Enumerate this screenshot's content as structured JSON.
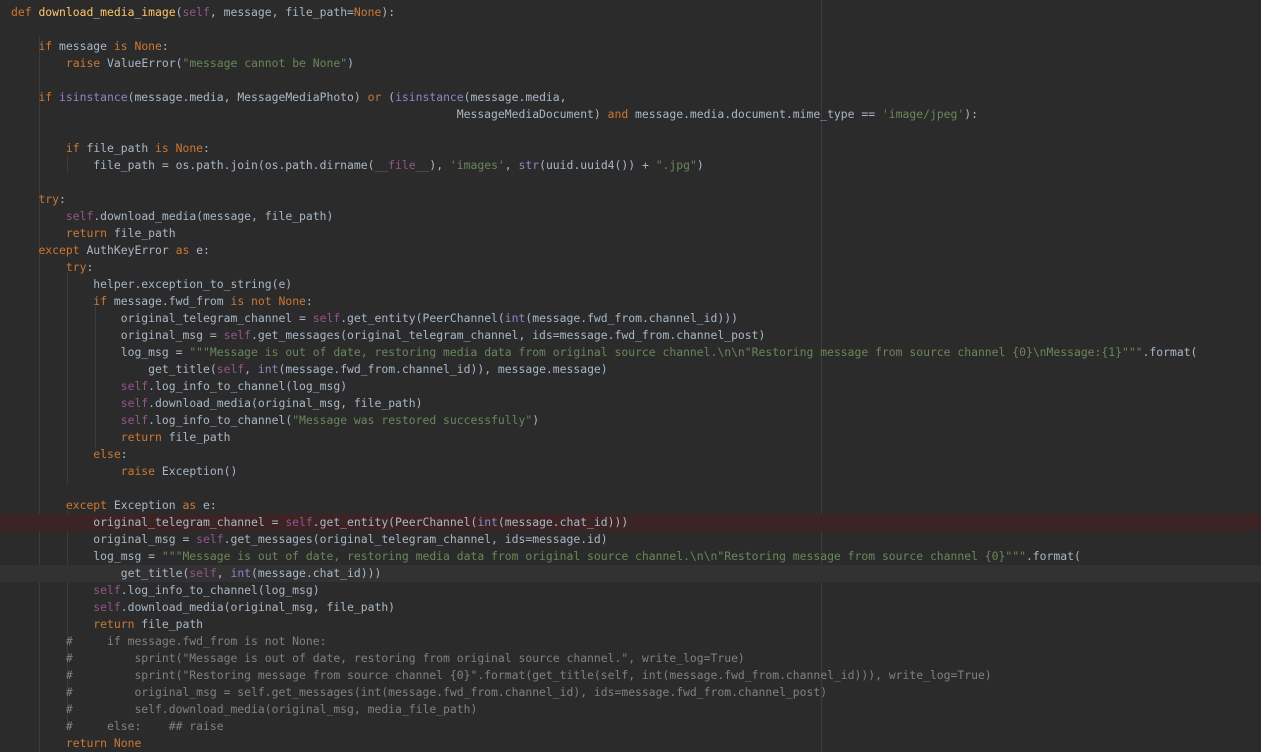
{
  "editor": {
    "language": "python",
    "theme_colors": {
      "background": "#2b2b2b",
      "default_text": "#a9b7c6",
      "keyword": "#cc7832",
      "function_name": "#ffc66d",
      "self": "#94558d",
      "string": "#6a8759",
      "builtin": "#8888c6",
      "comment": "#808080",
      "error_line": "#3d2424",
      "caret_line": "#323232"
    },
    "lines": [
      "def download_media_image(self, message, file_path=None):",
      "",
      "    if message is None:",
      "        raise ValueError(\"message cannot be None\")",
      "",
      "    if isinstance(message.media, MessageMediaPhoto) or (isinstance(message.media,",
      "                                                                 MessageMediaDocument) and message.media.document.mime_type == 'image/jpeg'):",
      "",
      "        if file_path is None:",
      "            file_path = os.path.join(os.path.dirname(__file__), 'images', str(uuid.uuid4()) + \".jpg\")",
      "",
      "    try:",
      "        self.download_media(message, file_path)",
      "        return file_path",
      "    except AuthKeyError as e:",
      "        try:",
      "            helper.exception_to_string(e)",
      "            if message.fwd_from is not None:",
      "                original_telegram_channel = self.get_entity(PeerChannel(int(message.fwd_from.channel_id)))",
      "                original_msg = self.get_messages(original_telegram_channel, ids=message.fwd_from.channel_post)",
      "                log_msg = \"\"\"Message is out of date, restoring media data from original source channel.\\n\\n\"Restoring message from source channel {0}\\nMessage:{1}\"\"\".format(",
      "                    get_title(self, int(message.fwd_from.channel_id)), message.message)",
      "                self.log_info_to_channel(log_msg)",
      "                self.download_media(original_msg, file_path)",
      "                self.log_info_to_channel(\"Message was restored successfully\")",
      "                return file_path",
      "            else:",
      "                raise Exception()",
      "",
      "        except Exception as e:",
      "            original_telegram_channel = self.get_entity(PeerChannel(int(message.chat_id)))",
      "            original_msg = self.get_messages(original_telegram_channel, ids=message.id)",
      "            log_msg = \"\"\"Message is out of date, restoring media data from original source channel.\\n\\n\"Restoring message from source channel {0}\"\"\".format(",
      "                get_title(self, int(message.chat_id)))",
      "            self.log_info_to_channel(log_msg)",
      "            self.download_media(original_msg, file_path)",
      "            return file_path",
      "        #     if message.fwd_from is not None:",
      "        #         sprint(\"Message is out of date, restoring from original source channel.\", write_log=True)",
      "        #         sprint(\"Restoring message from source channel {0}\".format(get_title(self, int(message.fwd_from.channel_id))), write_log=True)",
      "        #         original_msg = self.get_messages(int(message.fwd_from.channel_id), ids=message.fwd_from.channel_post)",
      "        #         self.download_media(original_msg, media_file_path)",
      "        #     else:    ## raise",
      "        return None"
    ]
  }
}
